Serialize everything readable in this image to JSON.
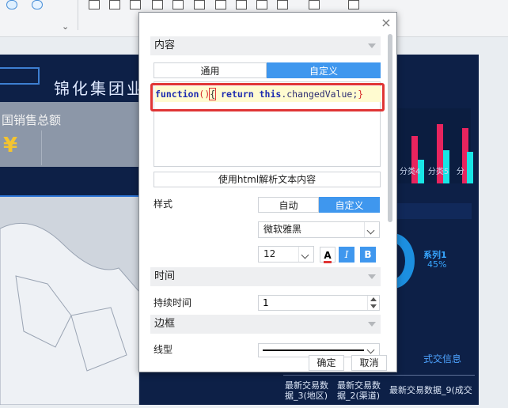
{
  "dashboard": {
    "title": "锦化集团业",
    "sales_label": "国销售总额",
    "currency_symbol": "¥",
    "chart_x_labels": [
      "分类4",
      "分类5",
      "分"
    ],
    "series_label": "系列1",
    "series_percent": "45%",
    "trade_info": "式交信息",
    "table_cells": [
      "最新交易数据_3(地区)",
      "最新交易数据_2(渠道)",
      "最新交易数据_9(成交"
    ]
  },
  "dialog": {
    "close_label": "×",
    "content_section": "内容",
    "tabs": [
      {
        "label": "通用",
        "active": false
      },
      {
        "label": "自定义",
        "active": true
      }
    ],
    "code": {
      "kw_function": "function",
      "parens": "()",
      "open_brace": "{",
      "kw_return": "return",
      "kw_this": "this",
      "rest": ".changedValue;",
      "close_brace": "}"
    },
    "html_parse_button": "使用html解析文本内容",
    "style_label": "样式",
    "style_tabs": [
      {
        "label": "自动",
        "active": false
      },
      {
        "label": "自定义",
        "active": true
      }
    ],
    "font_family": "微软雅黑",
    "font_size": "12",
    "format_buttons": {
      "color": "A",
      "italic": "I",
      "bold": "B"
    },
    "text_color": "#e03535",
    "time_section": "时间",
    "duration_label": "持续时间",
    "duration_value": "1",
    "border_section": "边框",
    "line_type_label": "线型",
    "ok_button": "确定",
    "cancel_button": "取消"
  }
}
